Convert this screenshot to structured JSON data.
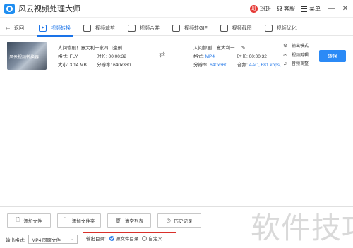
{
  "app": {
    "title": "风云视频处理大师"
  },
  "titlebar": {
    "badge": "班",
    "vip_label": "班班",
    "service_label": "客服",
    "menu_label": "菜单",
    "minimize": "—",
    "close": "✕"
  },
  "toolbar": {
    "back_label": "返回",
    "tabs": [
      {
        "label": "视频转换",
        "icon": "video-convert-icon",
        "active": true
      },
      {
        "label": "视频裁剪",
        "icon": "video-cut-icon",
        "active": false
      },
      {
        "label": "视频合并",
        "icon": "video-merge-icon",
        "active": false
      },
      {
        "label": "视频转GIF",
        "icon": "video-gif-icon",
        "active": false
      },
      {
        "label": "视频截图",
        "icon": "video-screenshot-icon",
        "active": false
      },
      {
        "label": "视频优化",
        "icon": "video-optimize-icon",
        "active": false
      }
    ]
  },
  "file": {
    "thumb_caption": "风云视频转换器",
    "source": {
      "name": "人间惨剧！意大利一家四口遭刑...",
      "format_label": "格式: FLV",
      "duration_label": "时长: 00:00:32",
      "size_label": "大小: 3.14 MB",
      "resolution_label": "分辨率: 640x360"
    },
    "target": {
      "name": "人间惨剧！意大利一...",
      "format_key": "格式:",
      "format_value": "MP4",
      "duration_label": "时长: 00:00:32",
      "resolution_key": "分辨率:",
      "resolution_value": "640x360",
      "audio_key": "音频:",
      "audio_value": "AAC, 681 kbps,..."
    },
    "actions": [
      "输出模式",
      "视频剪辑",
      "音频调整"
    ],
    "convert_label": "转换"
  },
  "bottom": {
    "buttons": [
      "添加文件",
      "添加文件夹",
      "清空列表",
      "历史记录"
    ],
    "format_label": "输出格式:",
    "format_value": "MP4 同原文件",
    "output_label": "输出目录:",
    "output_options": [
      "源文件目录",
      "自定义"
    ],
    "output_selected": 0
  },
  "watermark": "软件技巧",
  "colors": {
    "accent": "#2b8af6",
    "highlight_box": "#d9302a"
  }
}
